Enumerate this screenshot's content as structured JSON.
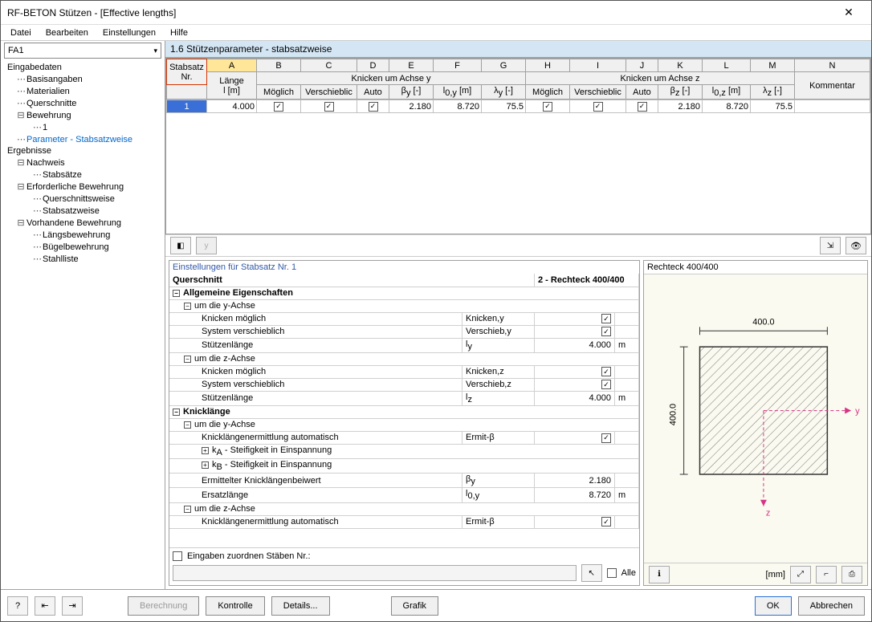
{
  "window": {
    "title": "RF-BETON Stützen - [Effective lengths]"
  },
  "menu": [
    "Datei",
    "Bearbeiten",
    "Einstellungen",
    "Hilfe"
  ],
  "combo": "FA1",
  "tree": {
    "section1": "Eingabedaten",
    "items1": [
      "Basisangaben",
      "Materialien",
      "Querschnitte"
    ],
    "bewehrung": "Bewehrung",
    "bewehrung_items": [
      "1"
    ],
    "param": "Parameter - Stabsatzweise",
    "section2": "Ergebnisse",
    "nachweis": "Nachweis",
    "nachweis_items": [
      "Stabsätze"
    ],
    "erf": "Erforderliche Bewehrung",
    "erf_items": [
      "Querschnittsweise",
      "Stabsatzweise"
    ],
    "vorh": "Vorhandene Bewehrung",
    "vorh_items": [
      "Längsbewehrung",
      "Bügelbewehrung",
      "Stahlliste"
    ]
  },
  "section_header": "1.6 Stützenparameter - stabsatzweise",
  "grid": {
    "letters": [
      "A",
      "B",
      "C",
      "D",
      "E",
      "F",
      "G",
      "H",
      "I",
      "J",
      "K",
      "L",
      "M",
      "N"
    ],
    "stabsatz_head": {
      "l1": "Stabsatz",
      "l2": "Nr."
    },
    "bandY": "Knicken um Achse y",
    "bandZ": "Knicken um Achse z",
    "cols": {
      "A1": "Länge",
      "A2": "l [m]",
      "B": "Möglich",
      "C": "Verschieblic",
      "D": "Auto",
      "E": "β<sub>y</sub> [-]",
      "F": "l<sub>0,y</sub> [m]",
      "G": "λ<sub>y</sub> [-]",
      "H": "Möglich",
      "I": "Verschieblic",
      "J": "Auto",
      "K": "β<sub>z</sub> [-]",
      "L": "l<sub>0,z</sub> [m]",
      "M": "λ<sub>z</sub> [-]",
      "N": "Kommentar"
    },
    "row": {
      "nr": "1",
      "A": "4.000",
      "B": true,
      "C": true,
      "D": true,
      "E": "2.180",
      "F": "8.720",
      "G": "75.5",
      "H": true,
      "I": true,
      "J": true,
      "K": "2.180",
      "L": "8.720",
      "M": "75.5",
      "N": ""
    }
  },
  "prop": {
    "title": "Einstellungen für Stabsatz Nr. 1",
    "querschnitt_label": "Querschnitt",
    "querschnitt_value": "2 - Rechteck 400/400",
    "grp_allg": "Allgemeine Eigenschaften",
    "grp_y": "um die y-Achse",
    "km_y": {
      "label": "Knicken möglich",
      "sym": "Knicken,y",
      "chk": true
    },
    "sv_y": {
      "label": "System verschieblich",
      "sym": "Verschieb,y",
      "chk": true
    },
    "sl_y": {
      "label": "Stützenlänge",
      "sym": "l<sub>y</sub>",
      "val": "4.000",
      "unit": "m"
    },
    "grp_z": "um die z-Achse",
    "km_z": {
      "label": "Knicken möglich",
      "sym": "Knicken,z",
      "chk": true
    },
    "sv_z": {
      "label": "System verschieblich",
      "sym": "Verschieb,z",
      "chk": true
    },
    "sl_z": {
      "label": "Stützenlänge",
      "sym": "l<sub>z</sub>",
      "val": "4.000",
      "unit": "m"
    },
    "grp_kl": "Knicklänge",
    "kl_y": "um die y-Achse",
    "kl_auto_y": {
      "label": "Knicklängenermittlung automatisch",
      "sym": "Ermit-β",
      "chk": true
    },
    "ka_y": "k<sub>A</sub> - Steifigkeit in Einspannung",
    "kb_y": "k<sub>B</sub> - Steifigkeit in Einspannung",
    "ekb_y": {
      "label": "Ermittelter Knicklängenbeiwert",
      "sym": "β<sub>y</sub>",
      "val": "2.180"
    },
    "el_y": {
      "label": "Ersatzlänge",
      "sym": "l<sub>0,y</sub>",
      "val": "8.720",
      "unit": "m"
    },
    "kl_z": "um die z-Achse",
    "kl_auto_z": {
      "label": "Knicklängenermittlung automatisch",
      "sym": "Ermit-β",
      "chk": true
    }
  },
  "assign": {
    "label": "Eingaben zuordnen Stäben Nr.:",
    "alle": "Alle"
  },
  "preview": {
    "title": "Rechteck 400/400",
    "dim_top": "400.0",
    "dim_left": "400.0",
    "unit": "[mm]",
    "axis_y": "y",
    "axis_z": "z"
  },
  "footer": {
    "berechnung": "Berechnung",
    "kontrolle": "Kontrolle",
    "details": "Details...",
    "grafik": "Grafik",
    "ok": "OK",
    "abbrechen": "Abbrechen"
  }
}
